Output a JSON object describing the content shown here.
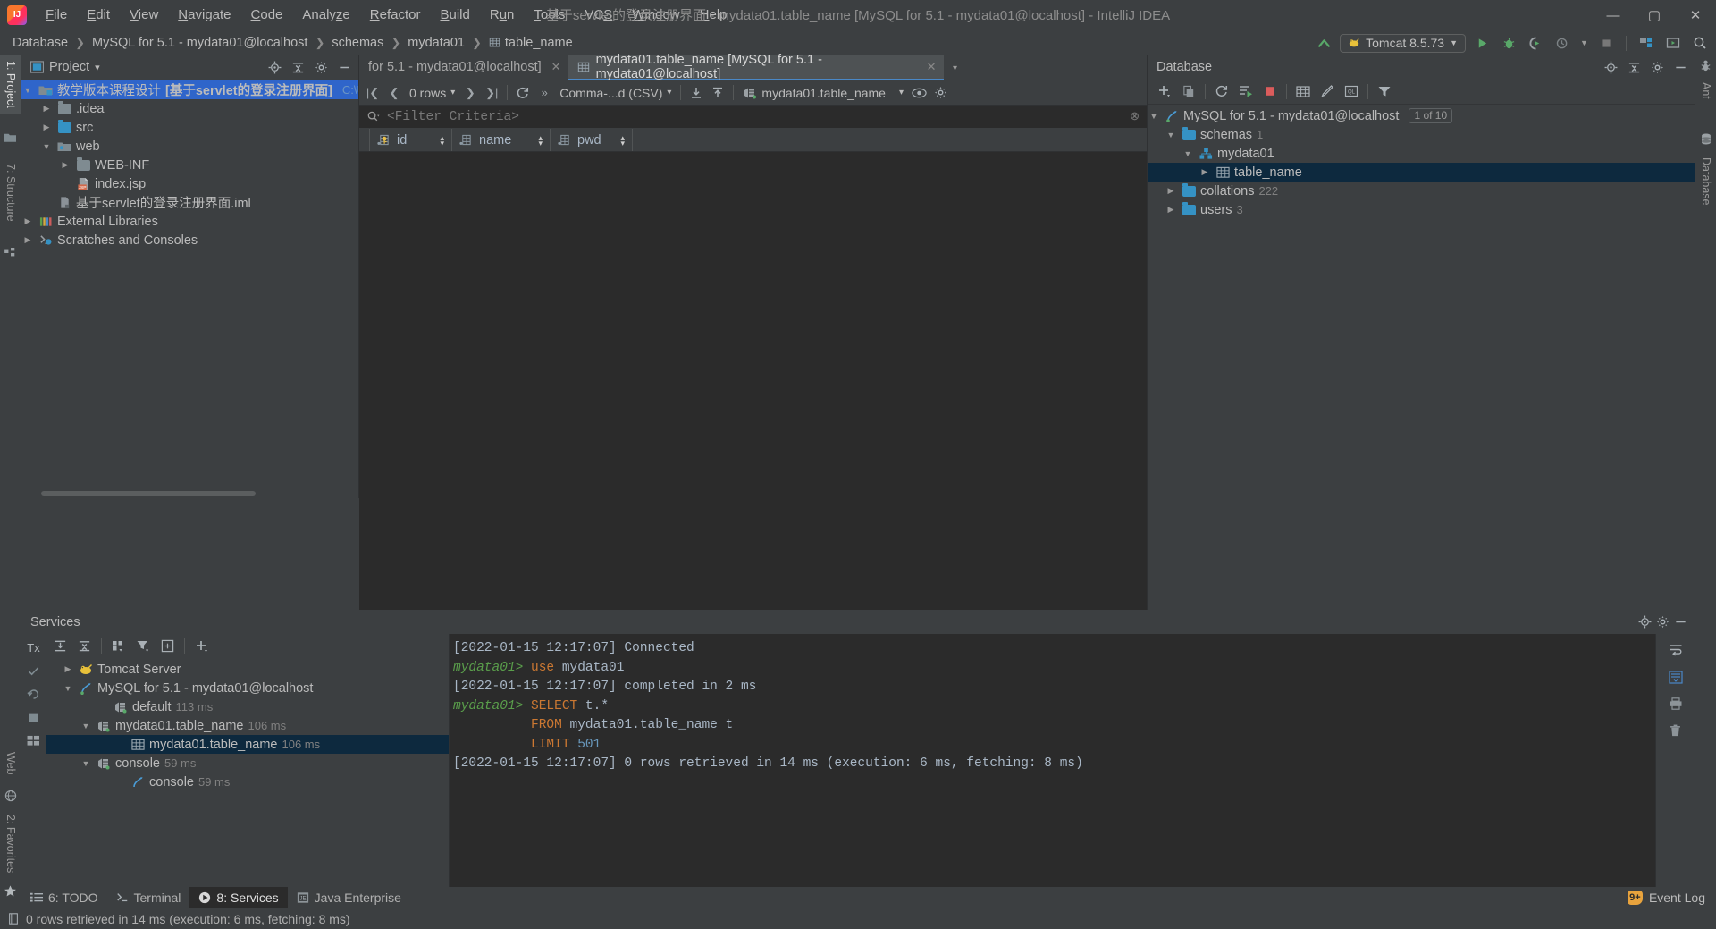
{
  "window": {
    "title": "基于servlet的登录注册界面 - mydata01.table_name [MySQL for 5.1 - mydata01@localhost] - IntelliJ IDEA",
    "minimize": "—",
    "maximize": "▢",
    "close": "✕",
    "logo_text": "IJ"
  },
  "menubar": {
    "items": [
      {
        "label": "File"
      },
      {
        "label": "Edit"
      },
      {
        "label": "View"
      },
      {
        "label": "Navigate"
      },
      {
        "label": "Code"
      },
      {
        "label": "Analyze"
      },
      {
        "label": "Refactor"
      },
      {
        "label": "Build"
      },
      {
        "label": "Run"
      },
      {
        "label": "Tools"
      },
      {
        "label": "VCS"
      },
      {
        "label": "Window"
      },
      {
        "label": "Help"
      }
    ]
  },
  "navbar": {
    "breadcrumb": [
      "Database",
      "MySQL for 5.1 - mydata01@localhost",
      "schemas",
      "mydata01",
      "table_name"
    ],
    "separator": "❯",
    "run_config": "Tomcat 8.5.73",
    "toolbar_icons": [
      "update-icon",
      "run-icon",
      "debug-icon",
      "run-coverage-icon",
      "profile-icon",
      "stop-icon",
      "project-structure-icon",
      "open-preview-icon",
      "search-everywhere-icon"
    ]
  },
  "left_tool_tabs": [
    {
      "label": "1: Project",
      "icon": "project-icon",
      "selected": true
    },
    {
      "label": "7: Structure",
      "icon": "structure-icon",
      "selected": false
    },
    {
      "label": "Web",
      "icon": "web-icon",
      "selected": false
    },
    {
      "label": "2: Favorites",
      "icon": "favorites-star-icon",
      "selected": false
    }
  ],
  "right_tool_tabs": [
    {
      "label": "Ant",
      "icon": "ant-icon"
    },
    {
      "label": "Database",
      "icon": "database-icon"
    }
  ],
  "project_panel": {
    "title": "Project",
    "dropdown": "▾",
    "header_icons": [
      "locate-icon",
      "collapse-all-icon",
      "settings-gear-icon",
      "hide-icon"
    ],
    "tree": [
      {
        "indent": 0,
        "arrow": "▼",
        "icon": "module-folder-icon",
        "label": "教学版本课程设计",
        "suffix": "[基于servlet的登录注册界面]",
        "path": "C:\\Users\\DEl",
        "selected": true,
        "bold_suffix": true
      },
      {
        "indent": 1,
        "arrow": "▶",
        "icon": "folder-icon",
        "label": ".idea"
      },
      {
        "indent": 1,
        "arrow": "▶",
        "icon": "folder-blue-icon",
        "label": "src"
      },
      {
        "indent": 1,
        "arrow": "▼",
        "icon": "folder-web-icon",
        "label": "web"
      },
      {
        "indent": 2,
        "arrow": "▶",
        "icon": "folder-icon",
        "label": "WEB-INF"
      },
      {
        "indent": 2,
        "arrow": "",
        "icon": "jsp-file-icon",
        "label": "index.jsp"
      },
      {
        "indent": 1,
        "arrow": "",
        "icon": "iml-file-icon",
        "label": "基于servlet的登录注册界面.iml"
      },
      {
        "indent": 0,
        "arrow": "▶",
        "icon": "libraries-icon",
        "label": "External Libraries"
      },
      {
        "indent": 0,
        "arrow": "▶",
        "icon": "scratches-icon",
        "label": "Scratches and Consoles"
      }
    ]
  },
  "editor": {
    "tabs": [
      {
        "label": "for 5.1 - mydata01@localhost]",
        "icon": "",
        "active": false,
        "close": "✕"
      },
      {
        "label": "mydata01.table_name [MySQL for 5.1 - mydata01@localhost]",
        "icon": "table-icon",
        "active": true,
        "close": "✕"
      }
    ],
    "tab_overflow": "▾",
    "data_toolbar": {
      "first_page": "|❮",
      "prev_page": "❮",
      "rows_label": "0 rows",
      "rows_dropdown": "▾",
      "next_page": "❯",
      "last_page": "❯|",
      "refresh": "⟳",
      "more": "»",
      "format": "Comma-...d (CSV)",
      "format_dropdown": "▾",
      "import": "⤓",
      "export": "⤒",
      "session": "mydata01.table_name",
      "session_dropdown": "▾",
      "view_mode": "👁",
      "settings": "⚙"
    },
    "filter": {
      "icon": "search-icon",
      "placeholder": "<Filter Criteria>",
      "clear": "⊗"
    },
    "grid": {
      "columns": [
        {
          "name": "id",
          "icon": "primary-key-column-icon",
          "sorter": "⇅"
        },
        {
          "name": "name",
          "icon": "column-icon",
          "sorter": "⇅"
        },
        {
          "name": "pwd",
          "icon": "column-icon",
          "sorter": "⇅"
        }
      ],
      "rows": []
    }
  },
  "database_panel": {
    "title": "Database",
    "header_icons": [
      "locate-icon",
      "collapse-all-icon",
      "settings-gear-icon",
      "hide-icon"
    ],
    "toolbar_icons": [
      "add-icon",
      "duplicate-icon",
      "refresh-icon",
      "run-sql-icon",
      "stop-icon",
      "table-editor-icon",
      "modify-icon",
      "query-console-icon",
      "filter-icon"
    ],
    "tree": [
      {
        "indent": 0,
        "arrow": "▼",
        "icon": "datasource-icon",
        "label": "MySQL for 5.1 - mydata01@localhost",
        "badge": "1 of 10"
      },
      {
        "indent": 1,
        "arrow": "▼",
        "icon": "folder-blue-icon",
        "label": "schemas",
        "count": "1"
      },
      {
        "indent": 2,
        "arrow": "▼",
        "icon": "schema-icon",
        "label": "mydata01"
      },
      {
        "indent": 3,
        "arrow": "▶",
        "icon": "table-icon",
        "label": "table_name",
        "selected": true
      },
      {
        "indent": 1,
        "arrow": "▶",
        "icon": "folder-blue-icon",
        "label": "collations",
        "count": "222"
      },
      {
        "indent": 1,
        "arrow": "▶",
        "icon": "folder-blue-icon",
        "label": "users",
        "count": "3"
      }
    ]
  },
  "services_panel": {
    "title": "Services",
    "header_icons": [
      "locate-icon",
      "settings-gear-icon",
      "hide-icon"
    ],
    "gutter_icons": [
      "tx-icon",
      "check-icon",
      "rollback-icon",
      "stop-icon",
      "layout-icon"
    ],
    "tx_label": "Tx",
    "toolbar_icons": [
      "expand-all-icon",
      "collapse-all-icon",
      "group-icon",
      "filter-icon",
      "add-tab-icon",
      "add-icon"
    ],
    "tree": [
      {
        "indent": 0,
        "arrow": "▶",
        "icon": "tomcat-icon",
        "label": "Tomcat Server",
        "time": ""
      },
      {
        "indent": 0,
        "arrow": "▼",
        "icon": "datasource-icon",
        "label": "MySQL for 5.1 - mydata01@localhost",
        "time": ""
      },
      {
        "indent": 1,
        "arrow": "",
        "icon": "connection-icon",
        "label": "default",
        "time": "113 ms"
      },
      {
        "indent": 1,
        "arrow": "▼",
        "icon": "connection-icon",
        "label": "mydata01.table_name",
        "time": "106 ms"
      },
      {
        "indent": 2,
        "arrow": "",
        "icon": "table-icon",
        "label": "mydata01.table_name",
        "time": "106 ms",
        "selected": true
      },
      {
        "indent": 1,
        "arrow": "▼",
        "icon": "connection-icon",
        "label": "console",
        "time": "59 ms"
      },
      {
        "indent": 2,
        "arrow": "",
        "icon": "datasource-icon",
        "label": "console",
        "time": "59 ms"
      }
    ],
    "console_lines": [
      [
        {
          "t": "[2022-01-15 12:17:07] Connected",
          "c": "c-txt"
        }
      ],
      [
        {
          "t": "mydata01> ",
          "c": "c-green"
        },
        {
          "t": "use",
          "c": "c-orange"
        },
        {
          "t": " mydata01",
          "c": "c-txt"
        }
      ],
      [
        {
          "t": "[2022-01-15 12:17:07] completed in 2 ms",
          "c": "c-txt"
        }
      ],
      [
        {
          "t": "mydata01> ",
          "c": "c-green"
        },
        {
          "t": "SELECT",
          "c": "c-orange"
        },
        {
          "t": " t.*",
          "c": "c-txt"
        }
      ],
      [
        {
          "t": "          ",
          "c": "c-txt"
        },
        {
          "t": "FROM",
          "c": "c-orange"
        },
        {
          "t": " mydata01.table_name t",
          "c": "c-txt"
        }
      ],
      [
        {
          "t": "          ",
          "c": "c-txt"
        },
        {
          "t": "LIMIT",
          "c": "c-orange"
        },
        {
          "t": " ",
          "c": "c-txt"
        },
        {
          "t": "501",
          "c": "c-blue"
        }
      ],
      [
        {
          "t": "[2022-01-15 12:17:07] 0 rows retrieved in 14 ms (execution: 6 ms, fetching: 8 ms)",
          "c": "c-txt"
        }
      ]
    ],
    "console_gutter_icons": [
      "wrap-icon",
      "scroll-end-icon",
      "print-icon",
      "trash-icon"
    ]
  },
  "bottom_tabs": [
    {
      "label": "6: TODO",
      "icon": "todo-icon",
      "active": false
    },
    {
      "label": "Terminal",
      "icon": "terminal-icon",
      "active": false
    },
    {
      "label": "8: Services",
      "icon": "services-run-icon",
      "active": true
    },
    {
      "label": "Java Enterprise",
      "icon": "java-enterprise-icon",
      "active": false
    }
  ],
  "event_log": {
    "badge": "9+",
    "label": "Event Log"
  },
  "statusbar": {
    "icon": "document-icon",
    "message": "0 rows retrieved in 14 ms (execution: 6 ms, fetching: 8 ms)"
  }
}
